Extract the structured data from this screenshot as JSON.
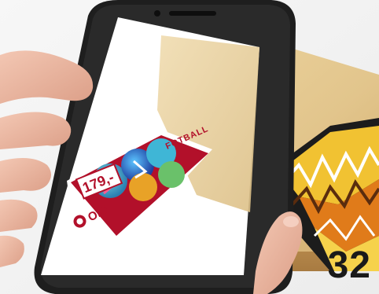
{
  "image": {
    "description_terms": [
      "hand",
      "smartphone",
      "wooden table",
      "printed flyer",
      "football ad"
    ]
  },
  "flyer": {
    "heading": "FOTBALL",
    "price": "179,-",
    "brand": "OKI"
  },
  "page": {
    "number": "32"
  },
  "colors": {
    "flyer_red": "#b2102a",
    "wood": "#e2c58c",
    "phone_body": "#1e1e1e"
  }
}
